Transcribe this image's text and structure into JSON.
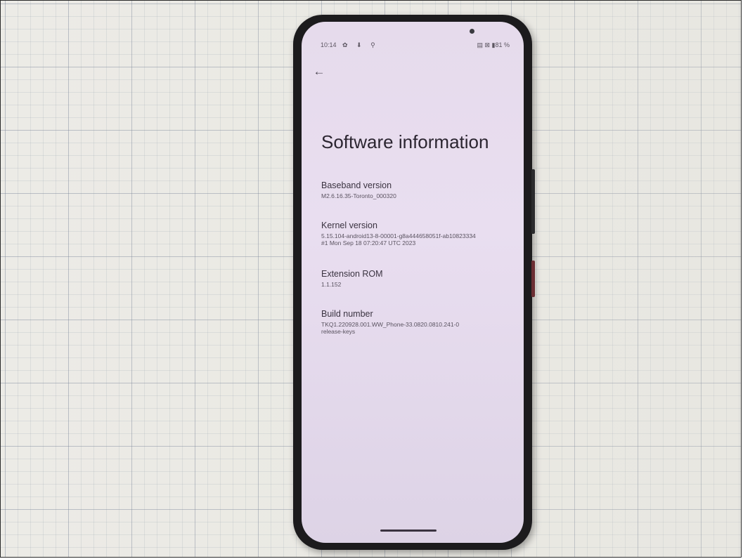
{
  "status_bar": {
    "time": "10:14",
    "left_icons": "✿ ⬇ ⚲",
    "right_text": "▤ ⊠ ▮81 %"
  },
  "icons": {
    "back": "arrow-left-icon"
  },
  "page": {
    "title": "Software information"
  },
  "info": {
    "baseband": {
      "label": "Baseband version",
      "value": "M2.6.16.35-Toronto_000320"
    },
    "kernel": {
      "label": "Kernel version",
      "value": "5.15.104-android13-8-00001-g8a444658051f-ab10823334\n#1 Mon Sep 18 07:20:47 UTC 2023"
    },
    "extension_rom": {
      "label": "Extension ROM",
      "value": "1.1.152"
    },
    "build_number": {
      "label": "Build number",
      "value": "TKQ1.220928.001.WW_Phone-33.0820.0810.241-0\nrelease-keys"
    }
  },
  "colors": {
    "screen_background": "#e6dbec",
    "text_primary": "#2b2530",
    "text_secondary": "#5a5360"
  }
}
